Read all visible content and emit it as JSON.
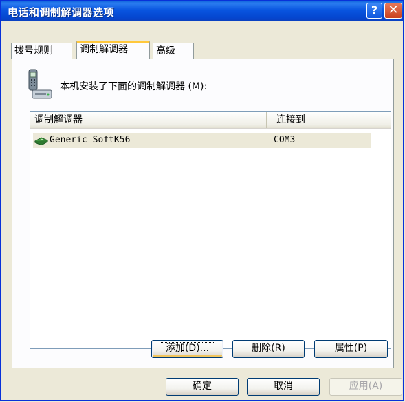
{
  "window": {
    "title": "电话和调制解调器选项",
    "help_glyph": "?",
    "close_glyph": "✕"
  },
  "tabs": [
    {
      "label": "拨号规则",
      "active": false
    },
    {
      "label": "调制解调器",
      "active": true
    },
    {
      "label": "高级",
      "active": false
    }
  ],
  "panel": {
    "description": "本机安装了下面的调制解调器 (M):",
    "icon": "phone-modem-icon"
  },
  "modem_list": {
    "columns": [
      "调制解调器",
      "连接到"
    ],
    "rows": [
      {
        "name": "Generic SoftK56",
        "port": "COM3",
        "icon": "modem-icon",
        "selected": true
      }
    ]
  },
  "panel_buttons": {
    "add": "添加(D)...",
    "remove": "删除(R)",
    "properties": "属性(P)"
  },
  "dialog_buttons": {
    "ok": "确定",
    "cancel": "取消",
    "apply": "应用(A)"
  },
  "colors": {
    "titlebar": "#0a55e0",
    "dialog_bg": "#ece9d8",
    "active_tab_accent": "#ffc83c"
  }
}
